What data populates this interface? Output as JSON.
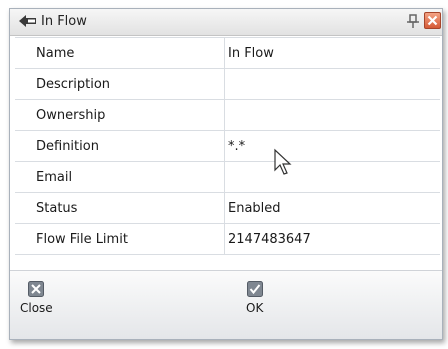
{
  "window": {
    "title": "In Flow",
    "icons": {
      "back": "back-arrow-icon",
      "pin": "pin-icon",
      "close": "close-icon"
    }
  },
  "properties": [
    {
      "key": "Name",
      "value": "In Flow"
    },
    {
      "key": "Description",
      "value": ""
    },
    {
      "key": "Ownership",
      "value": ""
    },
    {
      "key": "Definition",
      "value": "*.*"
    },
    {
      "key": "Email",
      "value": ""
    },
    {
      "key": "Status",
      "value": "Enabled"
    },
    {
      "key": "Flow File Limit",
      "value": "2147483647"
    }
  ],
  "toolbar": {
    "close_label": "Close",
    "ok_label": "OK"
  },
  "colors": {
    "close_button": "#d55a36",
    "grid_line": "#d9dde2",
    "titlebar": "#e8e8e8"
  }
}
